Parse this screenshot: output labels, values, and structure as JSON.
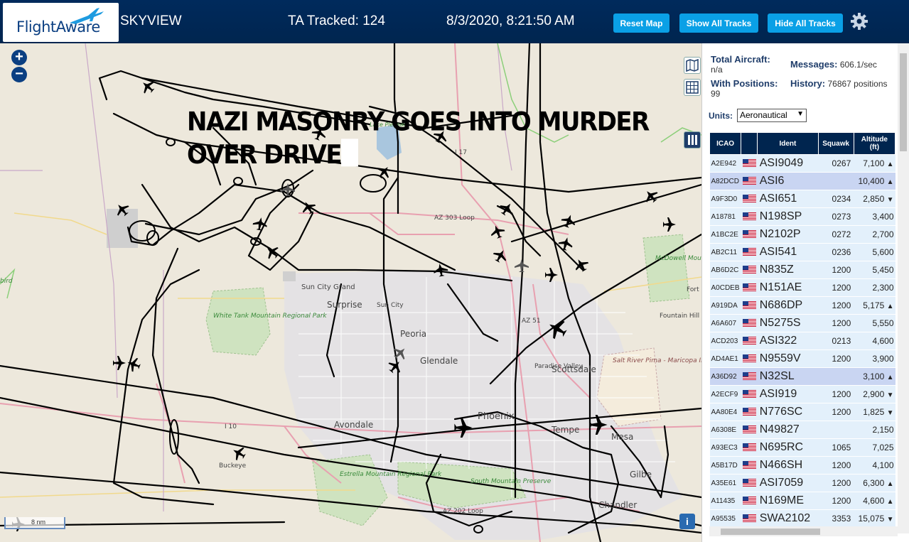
{
  "header": {
    "logo_text": "FlightAware",
    "app_name": "SKYVIEW",
    "tracked": "TA Tracked: 124",
    "datetime": "8/3/2020, 8:21:50 AM",
    "buttons": {
      "reset_map": "Reset Map",
      "show_all": "Show All Tracks",
      "hide_all": "Hide All Tracks"
    }
  },
  "map": {
    "overlay_line1": "NAZI MASONRY GOES INTO MURDER",
    "overlay_line2": "OVER DRIVE",
    "zoom_in": "+",
    "zoom_out": "−",
    "scale_text": "8 nm",
    "info": "i",
    "labels": {
      "lake_pleasant": "Lake Pleasant",
      "i17": "I 17",
      "az303": "AZ 303 Loop",
      "mcdowell": "McDowell Mountain Regional Park",
      "sun_city_grand": "Sun City Grand",
      "surprise": "Surprise",
      "sun_city": "Sun City",
      "white_tank": "White Tank Mountain Regional Park",
      "peoria": "Peoria",
      "az51": "AZ 51",
      "fountain_hills": "Fountain Hill",
      "fort": "Fort",
      "glendale": "Glendale",
      "paradise_valley": "Paradise Valley",
      "salt_river": "Salt River Pima - Maricopa Indian Community",
      "scottsdale": "Scottsdale",
      "i10": "I 10",
      "avondale": "Avondale",
      "phoenix": "Phoenix",
      "tempe": "Tempe",
      "mesa": "Mesa",
      "buckeye": "Buckeye",
      "estrella": "Estrella Mountain Regional Park",
      "south_mountain": "South Mountain Preserve",
      "gilbert": "Gilbe",
      "chandler": "Chandler",
      "az202": "AZ 202 Loop",
      "bird": "bird"
    }
  },
  "panel": {
    "total_aircraft_label": "Total Aircraft:",
    "total_aircraft_value": "n/a",
    "messages_label": "Messages:",
    "messages_value": "606.1/sec",
    "with_positions_label": "With Positions:",
    "with_positions_value": "99",
    "history_label": "History:",
    "history_value": "76867 positions",
    "units_label": "Units:",
    "units_value": "Aeronautical",
    "columns": {
      "icao": "ICAO",
      "ident": "Ident",
      "squawk": "Squawk",
      "altitude": "Altitude (ft)"
    },
    "rows": [
      {
        "icao": "A2E942",
        "ident": "ASI9049",
        "squawk": "0267",
        "altitude": "7,100",
        "trend": "▲"
      },
      {
        "icao": "A82DCD",
        "ident": "ASI6",
        "squawk": "",
        "altitude": "10,400",
        "trend": "▲"
      },
      {
        "icao": "A9F3D0",
        "ident": "ASI651",
        "squawk": "0234",
        "altitude": "2,850",
        "trend": "▼"
      },
      {
        "icao": "A18781",
        "ident": "N198SP",
        "squawk": "0273",
        "altitude": "3,400",
        "trend": ""
      },
      {
        "icao": "A1BC2E",
        "ident": "N2102P",
        "squawk": "0272",
        "altitude": "2,700",
        "trend": ""
      },
      {
        "icao": "AB2C11",
        "ident": "ASI541",
        "squawk": "0236",
        "altitude": "5,600",
        "trend": ""
      },
      {
        "icao": "AB6D2C",
        "ident": "N835Z",
        "squawk": "1200",
        "altitude": "5,450",
        "trend": ""
      },
      {
        "icao": "A0CDEB",
        "ident": "N151AE",
        "squawk": "1200",
        "altitude": "2,300",
        "trend": ""
      },
      {
        "icao": "A919DA",
        "ident": "N686DP",
        "squawk": "1200",
        "altitude": "5,175",
        "trend": "▲"
      },
      {
        "icao": "A6A607",
        "ident": "N5275S",
        "squawk": "1200",
        "altitude": "5,550",
        "trend": ""
      },
      {
        "icao": "ACD203",
        "ident": "ASI322",
        "squawk": "0213",
        "altitude": "4,600",
        "trend": ""
      },
      {
        "icao": "AD4AE1",
        "ident": "N9559V",
        "squawk": "1200",
        "altitude": "3,900",
        "trend": ""
      },
      {
        "icao": "A36D92",
        "ident": "N32SL",
        "squawk": "",
        "altitude": "3,100",
        "trend": "▲"
      },
      {
        "icao": "A2ECF9",
        "ident": "ASI919",
        "squawk": "1200",
        "altitude": "2,900",
        "trend": "▼"
      },
      {
        "icao": "AA80E4",
        "ident": "N776SC",
        "squawk": "1200",
        "altitude": "1,825",
        "trend": "▼"
      },
      {
        "icao": "A6308E",
        "ident": "N49827",
        "squawk": "",
        "altitude": "2,150",
        "trend": ""
      },
      {
        "icao": "A93EC3",
        "ident": "N695RC",
        "squawk": "1065",
        "altitude": "7,025",
        "trend": ""
      },
      {
        "icao": "A5B17D",
        "ident": "N466SH",
        "squawk": "1200",
        "altitude": "4,100",
        "trend": ""
      },
      {
        "icao": "A35E61",
        "ident": "ASI7059",
        "squawk": "1200",
        "altitude": "6,300",
        "trend": "▲"
      },
      {
        "icao": "A11435",
        "ident": "N169ME",
        "squawk": "1200",
        "altitude": "4,600",
        "trend": "▲"
      },
      {
        "icao": "A95535",
        "ident": "SWA2102",
        "squawk": "3353",
        "altitude": "15,075",
        "trend": "▼"
      }
    ],
    "selected_rows": [
      1,
      12
    ]
  }
}
